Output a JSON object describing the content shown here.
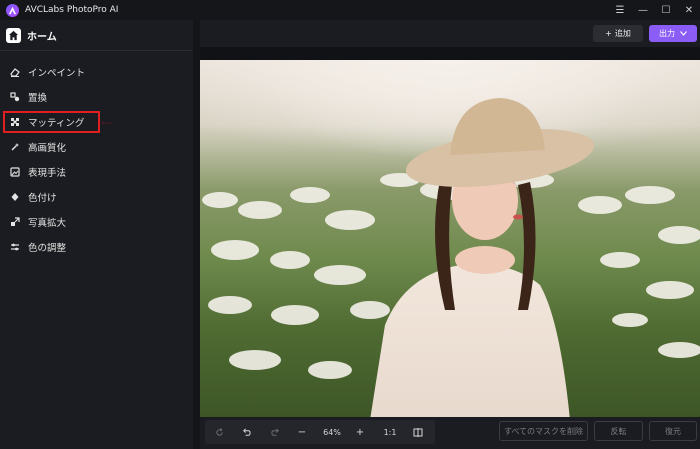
{
  "app": {
    "title": "AVCLabs PhotoPro AI"
  },
  "window_controls": {
    "menu": "☰",
    "minimize": "—",
    "maximize": "☐",
    "close": "✕"
  },
  "sidebar": {
    "home_label": "ホーム",
    "items": [
      {
        "label": "インペイント",
        "icon": "eraser-icon"
      },
      {
        "label": "置換",
        "icon": "replace-icon"
      },
      {
        "label": "マッティング",
        "icon": "matting-icon",
        "highlighted": true
      },
      {
        "label": "高画質化",
        "icon": "enhance-icon"
      },
      {
        "label": "表現手法",
        "icon": "style-icon"
      },
      {
        "label": "色付け",
        "icon": "colorize-icon"
      },
      {
        "label": "写真拡大",
        "icon": "upscale-icon"
      },
      {
        "label": "色の調整",
        "icon": "adjust-icon"
      }
    ]
  },
  "topbar": {
    "add_label": "追加",
    "export_label": "出力"
  },
  "toolbar": {
    "zoom": "64%",
    "ratio": "1:1",
    "clear_masks": "すべてのマスクを削除",
    "invert": "反転",
    "restore": "復元"
  },
  "colors": {
    "accent": "#8b5cf6",
    "highlight_red": "#e02020"
  }
}
